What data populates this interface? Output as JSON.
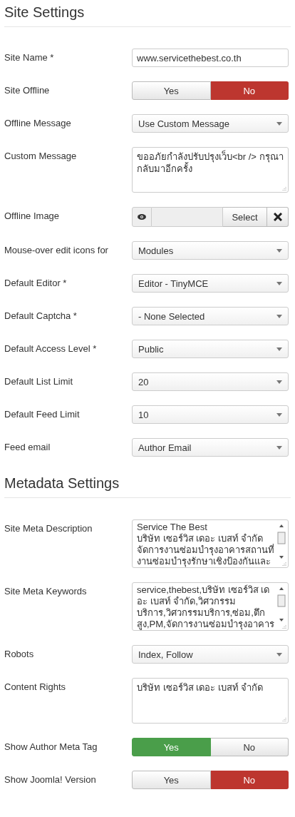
{
  "sections": [
    {
      "title": "Site Settings",
      "fields": [
        {
          "label": "Site Name *",
          "kind": "text",
          "value": "www.servicethebest.co.th"
        },
        {
          "label": "Site Offline",
          "kind": "toggle",
          "options": [
            {
              "label": "Yes",
              "selected": false
            },
            {
              "label": "No",
              "selected": true
            }
          ]
        },
        {
          "label": "Offline Message",
          "kind": "select",
          "value": "Use Custom Message"
        },
        {
          "label": "Custom Message",
          "kind": "textarea",
          "lines": [
            "ขออภัยกำลังปรับปรุงเว็บ<br /> กรุณา",
            "กลับมาอีกครั้ง"
          ]
        },
        {
          "label": "Offline Image",
          "kind": "media",
          "button": "Select"
        },
        {
          "label": "Mouse-over edit icons for",
          "kind": "select",
          "value": "Modules"
        },
        {
          "label": "Default Editor *",
          "kind": "select",
          "value": "Editor - TinyMCE"
        },
        {
          "label": "Default Captcha *",
          "kind": "select",
          "value": "- None Selected"
        },
        {
          "label": "Default Access Level *",
          "kind": "select",
          "value": "Public"
        },
        {
          "label": "Default List Limit",
          "kind": "select",
          "value": "20"
        },
        {
          "label": "Default Feed Limit",
          "kind": "select",
          "value": "10"
        },
        {
          "label": "Feed email",
          "kind": "select",
          "value": "Author Email"
        }
      ]
    },
    {
      "title": "Metadata Settings",
      "fields": [
        {
          "label": "Site Meta Description",
          "kind": "scroll_textarea",
          "lines": [
            "Service The Best",
            "บริษัท เซอร์วิส เดอะ เบสท์ จำกัด",
            "จัดการงานซ่อมบำรุงอาคารสถานที่",
            "งานซ่อมบำรุงรักษาเชิงป้องกันและ"
          ]
        },
        {
          "label": "Site Meta Keywords",
          "kind": "scroll_textarea",
          "lines": [
            "service,thebest,บริษัท เซอร์วิส เด",
            "อะ เบสท์ จำกัด,วิศวกรรม",
            "บริการ,วิศวกรรมบริการ,ซ่อม,ตึก",
            "สูง,PM,จัดการงานซ่อมบำรุงอาคาร"
          ]
        },
        {
          "label": "Robots",
          "kind": "select",
          "value": "Index, Follow"
        },
        {
          "label": "Content Rights",
          "kind": "textarea",
          "lines": [
            "บริษัท เซอร์วิส เดอะ เบสท์ จำกัด"
          ]
        },
        {
          "label": "Show Author Meta Tag",
          "kind": "toggle",
          "options": [
            {
              "label": "Yes",
              "selected": true
            },
            {
              "label": "No",
              "selected": false
            }
          ]
        },
        {
          "label": "Show Joomla! Version",
          "kind": "toggle",
          "options": [
            {
              "label": "Yes",
              "selected": false
            },
            {
              "label": "No",
              "selected": true
            }
          ]
        }
      ]
    }
  ]
}
